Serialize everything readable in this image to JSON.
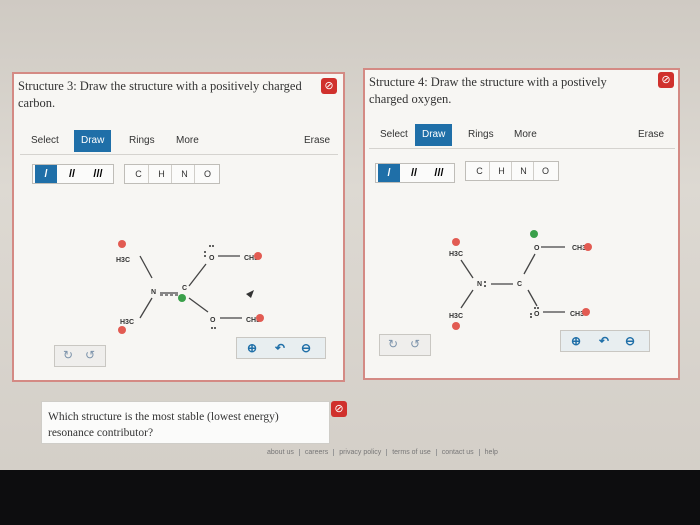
{
  "structure3": {
    "title": "Structure 3: Draw the structure with a positively charged carbon.",
    "tools": [
      "Select",
      "Draw",
      "Rings",
      "More"
    ],
    "active_tool": "Draw",
    "erase": "Erase",
    "bonds": [
      "/",
      "//",
      "///"
    ],
    "atoms": [
      "C",
      "H",
      "N",
      "O"
    ],
    "atom_labels": {
      "h3c_top": "H3C",
      "h3c_bottom": "H3C",
      "n": "N",
      "c": "C",
      "o_top": "O",
      "ch3_top": "CH3",
      "o_bottom": "O",
      "ch3_bottom": "CH3"
    }
  },
  "structure4": {
    "title": "Structure 4: Draw the structure with a postively charged oxygen.",
    "tools": [
      "Select",
      "Draw",
      "Rings",
      "More"
    ],
    "active_tool": "Draw",
    "erase": "Erase",
    "bonds": [
      "/",
      "//",
      "///"
    ],
    "atoms": [
      "C",
      "H",
      "N",
      "O"
    ],
    "atom_labels": {
      "h3c_top": "H3C",
      "h3c_bottom": "H3C",
      "n": "N",
      "c": "C",
      "o_top": "O",
      "ch3_top": "CH3",
      "o_bottom": "O",
      "ch3_bottom": "CH3"
    }
  },
  "question": "Which structure is the most stable (lowest energy) resonance contributor?",
  "footer": [
    "about us",
    "careers",
    "privacy policy",
    "terms of use",
    "contact us",
    "help"
  ],
  "icons": {
    "error": "prohibit-icon",
    "undo": "undo-icon",
    "redo": "redo-icon",
    "zoom_in": "zoom-in-icon",
    "reset": "reset-zoom-icon",
    "zoom_out": "zoom-out-icon"
  },
  "colors": {
    "accent": "#1f6fa8",
    "error": "#d0312d",
    "border": "#d48a84",
    "charge_red": "#e25b52",
    "charge_green": "#3aa04a"
  }
}
